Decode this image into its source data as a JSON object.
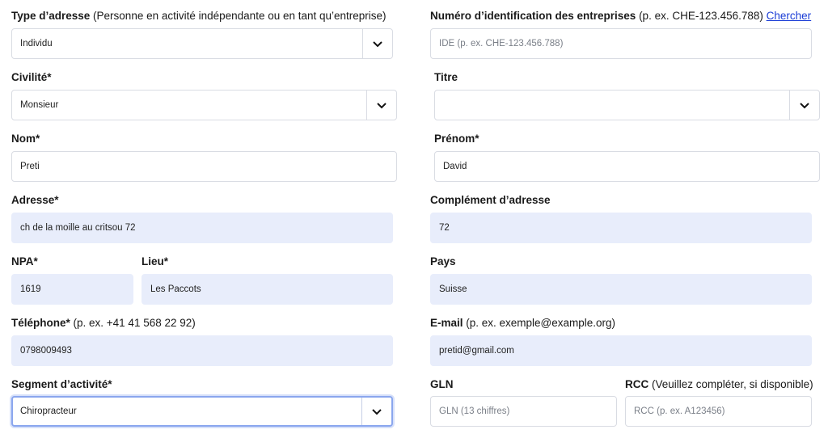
{
  "type_adresse": {
    "label": "Type d’adresse",
    "hint": " (Personne en activité indépendante ou en tant qu’entreprise)",
    "value": "Individu",
    "icon": "chevron-down-icon"
  },
  "ide": {
    "label": "Numéro d’identification des entreprises",
    "hint": " (p. ex. CHE-123.456.788) ",
    "link": "Chercher",
    "placeholder": "IDE (p. ex. CHE-123.456.788)"
  },
  "civilite": {
    "label": "Civilité*",
    "value": "Monsieur",
    "icon": "chevron-down-icon"
  },
  "titre": {
    "label": "Titre",
    "value": "",
    "icon": "chevron-down-icon"
  },
  "nom": {
    "label": "Nom*",
    "value": "Preti"
  },
  "prenom": {
    "label": "Prénom*",
    "value": "David"
  },
  "adresse": {
    "label": "Adresse*",
    "value": "ch de la moille au critsou 72"
  },
  "complement": {
    "label": "Complément d’adresse",
    "value": "72"
  },
  "npa": {
    "label": "NPA*",
    "value": "1619"
  },
  "lieu": {
    "label": "Lieu*",
    "value": "Les Paccots"
  },
  "pays": {
    "label": "Pays",
    "value": "Suisse"
  },
  "telephone": {
    "label": "Téléphone*",
    "hint": " (p. ex. +41 41 568 22 92)",
    "value": "0798009493"
  },
  "email": {
    "label": "E-mail",
    "hint": " (p. ex. exemple@example.org)",
    "value": "pretid@gmail.com"
  },
  "segment": {
    "label": "Segment d’activité*",
    "value": "Chiropracteur",
    "icon": "chevron-down-icon"
  },
  "gln": {
    "label": "GLN",
    "placeholder": "GLN (13 chiffres)"
  },
  "rcc": {
    "label": "RCC",
    "hint": " (Veuillez compléter, si disponible)",
    "placeholder": "RCC (p. ex. A123456)"
  },
  "colors": {
    "filled_bg": "#e8edfb",
    "border": "#d9dce3",
    "focus_border": "#8aa6ee",
    "link": "#1a3cd6"
  }
}
